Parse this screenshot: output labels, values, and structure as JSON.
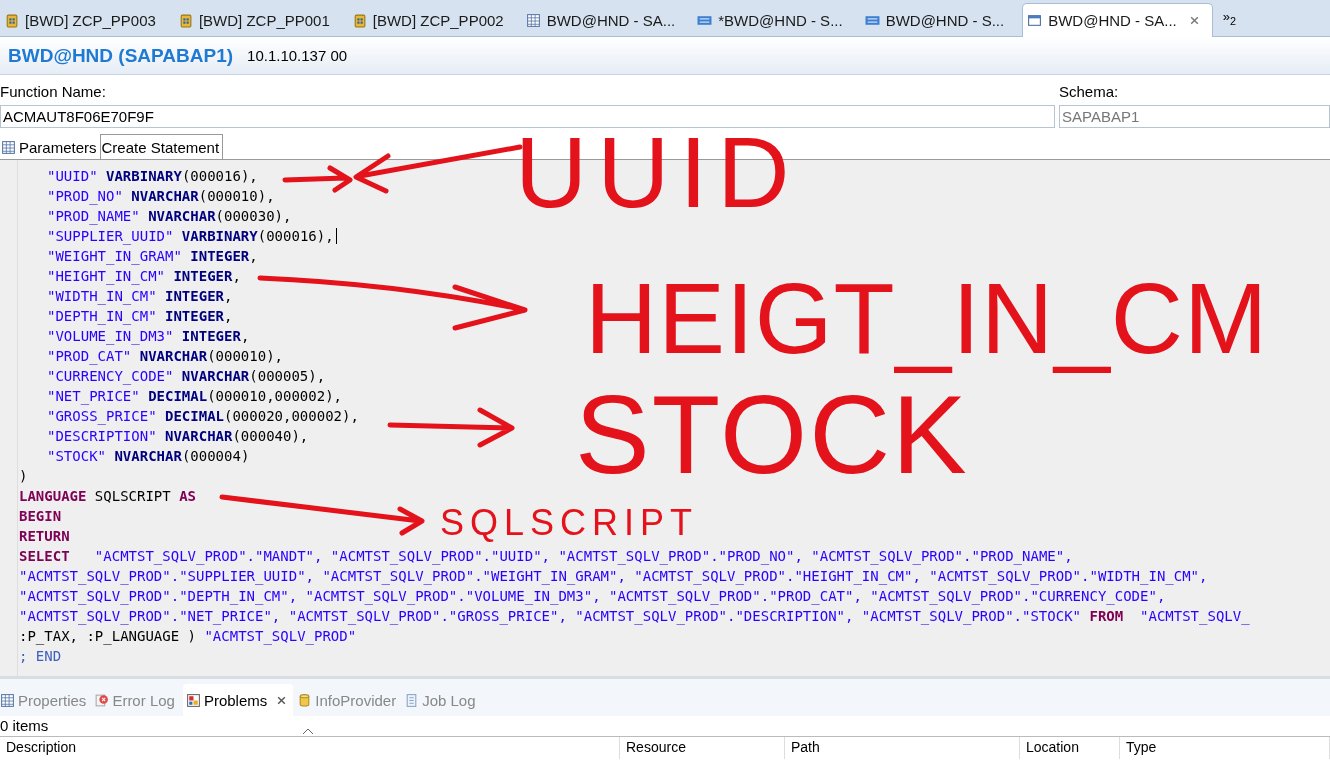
{
  "editor_tabs": [
    {
      "label": "[BWD] ZCP_PP003",
      "kind": "cube",
      "selected": false
    },
    {
      "label": "[BWD] ZCP_PP001",
      "kind": "cube",
      "selected": false
    },
    {
      "label": "[BWD] ZCP_PP002",
      "kind": "cube",
      "selected": false
    },
    {
      "label": "BWD@HND - SA...",
      "kind": "table",
      "selected": false
    },
    {
      "label": "*BWD@HND - S...",
      "kind": "sql",
      "selected": false
    },
    {
      "label": "BWD@HND - S...",
      "kind": "sql",
      "selected": false
    },
    {
      "label": "BWD@HND - SA...",
      "kind": "window",
      "selected": true
    }
  ],
  "tab_overflow": "»$_{2}$",
  "header": {
    "title": "BWD@HND (SAPABAP1)",
    "subtitle": "10.1.10.137 00"
  },
  "function_name": {
    "label": "Function Name:",
    "value": "ACMAUT8F06E70F9F"
  },
  "schema": {
    "label": "Schema:",
    "value": "SAPABAP1",
    "disabled": true
  },
  "sub_tabs": [
    {
      "label": "Parameters",
      "kind": "table",
      "selected": false
    },
    {
      "label": "Create Statement",
      "kind": "plain",
      "selected": true
    }
  ],
  "column_lines": [
    {
      "cursor": false,
      "tokens": [
        {
          "kind": "str",
          "text": "\"UUID\""
        },
        {
          "kind": "type",
          "text": " VARBINARY"
        },
        {
          "kind": "plain",
          "text": "(000016),"
        }
      ]
    },
    {
      "cursor": false,
      "tokens": [
        {
          "kind": "str",
          "text": "\"PROD_NO\""
        },
        {
          "kind": "type",
          "text": " NVARCHAR"
        },
        {
          "kind": "plain",
          "text": "(000010),"
        }
      ]
    },
    {
      "cursor": false,
      "tokens": [
        {
          "kind": "str",
          "text": "\"PROD_NAME\""
        },
        {
          "kind": "type",
          "text": " NVARCHAR"
        },
        {
          "kind": "plain",
          "text": "(000030),"
        }
      ]
    },
    {
      "cursor": true,
      "tokens": [
        {
          "kind": "str",
          "text": "\"SUPPLIER_UUID\""
        },
        {
          "kind": "type",
          "text": " VARBINARY"
        },
        {
          "kind": "plain",
          "text": "(000016),"
        }
      ]
    },
    {
      "cursor": false,
      "tokens": [
        {
          "kind": "str",
          "text": "\"WEIGHT_IN_GRAM\""
        },
        {
          "kind": "type",
          "text": " INTEGER"
        },
        {
          "kind": "plain",
          "text": ","
        }
      ]
    },
    {
      "cursor": false,
      "tokens": [
        {
          "kind": "str",
          "text": "\"HEIGHT_IN_CM\""
        },
        {
          "kind": "type",
          "text": " INTEGER"
        },
        {
          "kind": "plain",
          "text": ","
        }
      ]
    },
    {
      "cursor": false,
      "tokens": [
        {
          "kind": "str",
          "text": "\"WIDTH_IN_CM\""
        },
        {
          "kind": "type",
          "text": " INTEGER"
        },
        {
          "kind": "plain",
          "text": ","
        }
      ]
    },
    {
      "cursor": false,
      "tokens": [
        {
          "kind": "str",
          "text": "\"DEPTH_IN_CM\""
        },
        {
          "kind": "type",
          "text": " INTEGER"
        },
        {
          "kind": "plain",
          "text": ","
        }
      ]
    },
    {
      "cursor": false,
      "tokens": [
        {
          "kind": "str",
          "text": "\"VOLUME_IN_DM3\""
        },
        {
          "kind": "type",
          "text": " INTEGER"
        },
        {
          "kind": "plain",
          "text": ","
        }
      ]
    },
    {
      "cursor": false,
      "tokens": [
        {
          "kind": "str",
          "text": "\"PROD_CAT\""
        },
        {
          "kind": "type",
          "text": " NVARCHAR"
        },
        {
          "kind": "plain",
          "text": "(000010),"
        }
      ]
    },
    {
      "cursor": false,
      "tokens": [
        {
          "kind": "str",
          "text": "\"CURRENCY_CODE\""
        },
        {
          "kind": "type",
          "text": " NVARCHAR"
        },
        {
          "kind": "plain",
          "text": "(000005),"
        }
      ]
    },
    {
      "cursor": false,
      "tokens": [
        {
          "kind": "str",
          "text": "\"NET_PRICE\""
        },
        {
          "kind": "type",
          "text": " DECIMAL"
        },
        {
          "kind": "plain",
          "text": "(000010,000002),"
        }
      ]
    },
    {
      "cursor": false,
      "tokens": [
        {
          "kind": "str",
          "text": "\"GROSS_PRICE\""
        },
        {
          "kind": "type",
          "text": " DECIMAL"
        },
        {
          "kind": "plain",
          "text": "(000020,000002),"
        }
      ]
    },
    {
      "cursor": false,
      "tokens": [
        {
          "kind": "str",
          "text": "\"DESCRIPTION\""
        },
        {
          "kind": "type",
          "text": " NVARCHAR"
        },
        {
          "kind": "plain",
          "text": "(000040),"
        }
      ]
    },
    {
      "cursor": false,
      "tokens": [
        {
          "kind": "str",
          "text": "\"STOCK\""
        },
        {
          "kind": "type",
          "text": " NVARCHAR"
        },
        {
          "kind": "plain",
          "text": "(000004)"
        }
      ]
    }
  ],
  "body_lines": [
    {
      "tokens": [
        {
          "kind": "plain",
          "text": ")"
        }
      ]
    },
    {
      "tokens": [
        {
          "kind": "kw",
          "text": "LANGUAGE"
        },
        {
          "kind": "plain",
          "text": " SQLSCRIPT "
        },
        {
          "kind": "kw",
          "text": "AS"
        }
      ]
    },
    {
      "tokens": [
        {
          "kind": "kw",
          "text": "BEGIN"
        }
      ]
    },
    {
      "tokens": [
        {
          "kind": "kw",
          "text": "RETURN"
        }
      ]
    },
    {
      "tokens": [
        {
          "kind": "kw",
          "text": "SELECT"
        },
        {
          "kind": "str",
          "text": "   \"ACMTST_SQLV_PROD\".\"MANDT\", \"ACMTST_SQLV_PROD\".\"UUID\", \"ACMTST_SQLV_PROD\".\"PROD_NO\", \"ACMTST_SQLV_PROD\".\"PROD_NAME\","
        }
      ]
    },
    {
      "tokens": [
        {
          "kind": "str",
          "text": "\"ACMTST_SQLV_PROD\".\"SUPPLIER_UUID\", \"ACMTST_SQLV_PROD\".\"WEIGHT_IN_GRAM\", \"ACMTST_SQLV_PROD\".\"HEIGHT_IN_CM\", \"ACMTST_SQLV_PROD\".\"WIDTH_IN_CM\","
        }
      ]
    },
    {
      "tokens": [
        {
          "kind": "str",
          "text": "\"ACMTST_SQLV_PROD\".\"DEPTH_IN_CM\", \"ACMTST_SQLV_PROD\".\"VOLUME_IN_DM3\", \"ACMTST_SQLV_PROD\".\"PROD_CAT\", \"ACMTST_SQLV_PROD\".\"CURRENCY_CODE\","
        }
      ]
    },
    {
      "tokens": [
        {
          "kind": "str",
          "text": "\"ACMTST_SQLV_PROD\".\"NET_PRICE\", \"ACMTST_SQLV_PROD\".\"GROSS_PRICE\", \"ACMTST_SQLV_PROD\".\"DESCRIPTION\", \"ACMTST_SQLV_PROD\".\"STOCK\" "
        },
        {
          "kind": "kw",
          "text": "FROM"
        },
        {
          "kind": "str",
          "text": "  \"ACMTST_SQLV_"
        }
      ]
    },
    {
      "tokens": [
        {
          "kind": "plain",
          "text": ":P_TAX, :P_LANGUAGE ) "
        },
        {
          "kind": "str",
          "text": "\"ACMTST_SQLV_PROD\""
        }
      ]
    },
    {
      "tokens": [
        {
          "kind": "end",
          "text": "; END"
        }
      ]
    }
  ],
  "annotations": [
    {
      "text": "UUID"
    },
    {
      "text": "HEIGT_IN_CM"
    },
    {
      "text": "STOCK"
    },
    {
      "text": "SQLSCRIPT"
    }
  ],
  "view_tabs": [
    {
      "label": "Properties",
      "kind": "table",
      "selected": false
    },
    {
      "label": "Error Log",
      "kind": "error",
      "selected": false
    },
    {
      "label": "Problems",
      "kind": "problems",
      "selected": true
    },
    {
      "label": "InfoProvider",
      "kind": "cylinder",
      "selected": false
    },
    {
      "label": "Job Log",
      "kind": "log",
      "selected": false
    }
  ],
  "problems": {
    "count": "0 items",
    "columns": [
      "Description",
      "Resource",
      "Path",
      "Location",
      "Type"
    ]
  }
}
